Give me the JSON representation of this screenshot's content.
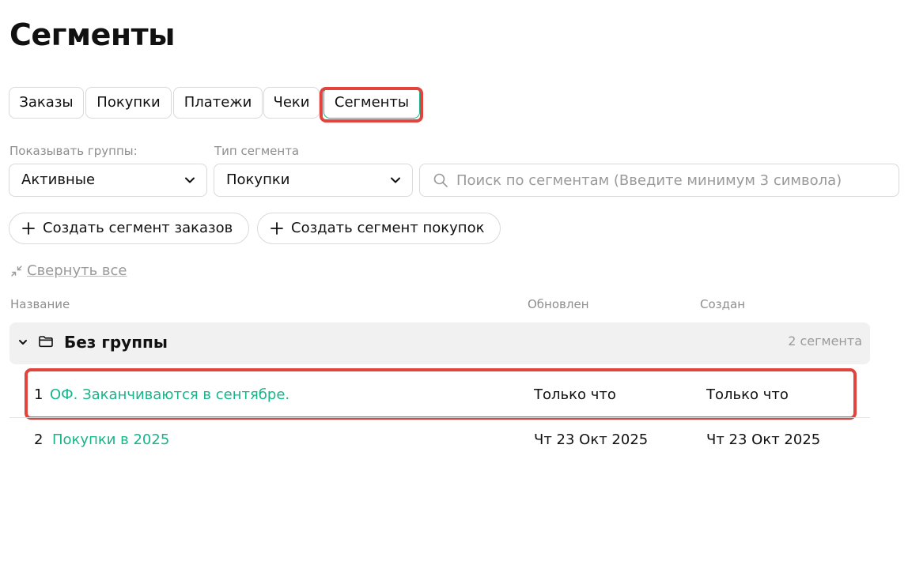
{
  "page": {
    "title": "Сегменты"
  },
  "tabs": [
    {
      "label": "Заказы"
    },
    {
      "label": "Покупки"
    },
    {
      "label": "Платежи"
    },
    {
      "label": "Чеки"
    },
    {
      "label": "Сегменты",
      "active": true
    }
  ],
  "filters": {
    "groups": {
      "label": "Показывать группы:",
      "value": "Активные"
    },
    "segment_type": {
      "label": "Тип сегмента",
      "value": "Покупки"
    },
    "search": {
      "placeholder": "Поиск по сегментам (Введите минимум 3 символа)",
      "value": ""
    }
  },
  "actions": {
    "create_orders_segment": "Создать сегмент заказов",
    "create_purchases_segment": "Создать сегмент покупок",
    "collapse_all": "Свернуть все"
  },
  "table": {
    "columns": {
      "name": "Название",
      "updated": "Обновлен",
      "created": "Создан"
    },
    "group": {
      "name": "Без группы",
      "count": "2 сегмента"
    },
    "rows": [
      {
        "num": "1",
        "name": "ОФ. Заканчиваются в сентябре.",
        "updated": "Только что",
        "created": "Только что"
      },
      {
        "num": "2",
        "name": "Покупки в 2025",
        "updated": "Чт 23 Окт 2025",
        "created": "Чт 23 Окт 2025"
      }
    ]
  },
  "icons": {
    "select_chevron": "chevron-down-icon",
    "search": "search-icon",
    "create": "plus-icon",
    "collapse_all": "collapse-arrows-icon",
    "group_toggle": "chevron-down-icon",
    "group": "folder-icon"
  },
  "colors": {
    "accent": "#19b48a",
    "highlight": "#e0443c",
    "muted_text": "#8e8e8e",
    "group_background": "#f1f1f1"
  }
}
